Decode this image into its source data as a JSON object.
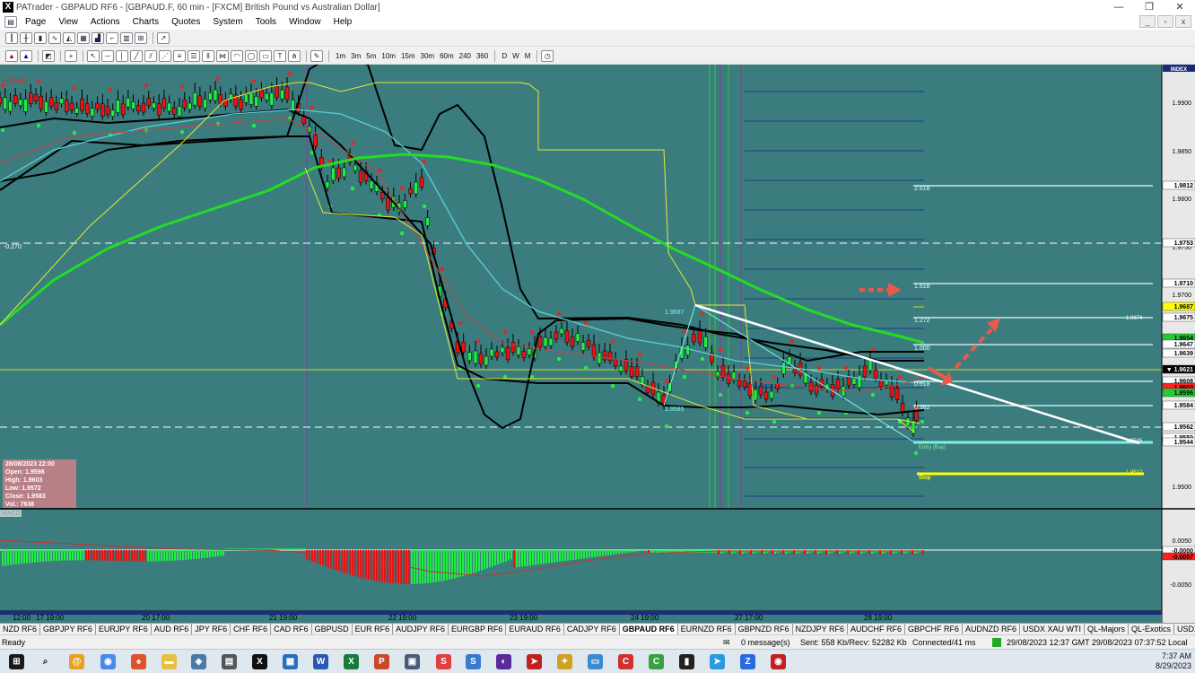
{
  "app": {
    "title": "PATrader - GBPAUD RF6 - [GBPAUD.F, 60 min - [FXCM] British Pound vs Australian Dollar]",
    "window_buttons": [
      "—",
      "❐",
      "✕"
    ]
  },
  "menu": [
    "Page",
    "View",
    "Actions",
    "Charts",
    "Quotes",
    "System",
    "Tools",
    "Window",
    "Help"
  ],
  "mdi_buttons": [
    "_",
    "▫",
    "x"
  ],
  "timeframes": [
    "1m",
    "3m",
    "5m",
    "10m",
    "15m",
    "30m",
    "60m",
    "240",
    "360",
    "D",
    "W",
    "M"
  ],
  "chart": {
    "symbol_panel_label": "INDEX",
    "locked_label": "Locked",
    "left_level_label": "-0.270",
    "y_ticks": [
      "1.9900",
      "1.9850",
      "1.9800",
      "1.9750",
      "1.9700",
      "1.9650",
      "1.9600",
      "1.9550",
      "1.9500"
    ],
    "price_tags": [
      {
        "text": "1.9812",
        "bg": "#ffffff",
        "fg": "#000000"
      },
      {
        "text": "1.9753",
        "bg": "#ffffff",
        "fg": "#000000"
      },
      {
        "text": "1.9710",
        "bg": "#ffffff",
        "fg": "#000000"
      },
      {
        "text": "1.9687",
        "bg": "#ffff00",
        "fg": "#000000"
      },
      {
        "text": "1.9675",
        "bg": "#ffffff",
        "fg": "#000000"
      },
      {
        "text": "1.9654",
        "bg": "#22cc33",
        "fg": "#000000"
      },
      {
        "text": "1.9647",
        "bg": "#ffffff",
        "fg": "#000000"
      },
      {
        "text": "1.9639",
        "bg": "#ffffff",
        "fg": "#000000"
      },
      {
        "text": "▼ 1.9621",
        "bg": "#000000",
        "fg": "#ffffff"
      },
      {
        "text": "1.9608",
        "bg": "#ffffff",
        "fg": "#000000"
      },
      {
        "text": "1.9603",
        "bg": "#ff2020",
        "fg": "#000000"
      },
      {
        "text": "1.9596",
        "bg": "#22cc33",
        "fg": "#000000"
      },
      {
        "text": "1.9584",
        "bg": "#ffffff",
        "fg": "#000000"
      },
      {
        "text": "1.9562",
        "bg": "#ffffff",
        "fg": "#000000"
      },
      {
        "text": "1.9550",
        "bg": "#ffffff",
        "fg": "#000000"
      },
      {
        "text": "1.9544",
        "bg": "#ffffff",
        "fg": "#000000"
      }
    ],
    "fib_labels": [
      "2.618",
      "1.618",
      "1.272",
      "1.000",
      "0.618",
      "0.382"
    ],
    "annotations": {
      "high": "1.9687",
      "low": "1.9585",
      "base": "End Base",
      "target1": "1.9674",
      "entry": "Entry (Buy)",
      "entry_price": "1.9545",
      "stop": "Stop",
      "stop_price": "1.9512"
    },
    "x_labels": [
      "12:00",
      "17 19:00",
      "20 17:00",
      "21 19:00",
      "22 19:00",
      "23 19:00",
      "24 19:00",
      "27 17:00",
      "28 19:00"
    ],
    "info_box": [
      "28/08/2023 22:00",
      "Open: 1.9598",
      "High: 1.9603",
      "Low: 1.9572",
      "Close: 1.9583",
      "Vol.: 7638"
    ],
    "macd": {
      "label": "MACD",
      "y_ticks": [
        "0.0050",
        "0.0000",
        "-0.0050"
      ],
      "tag_white": "-0.0000",
      "tag_red": "-0.0007"
    }
  },
  "tabs": [
    "NZD RF6",
    "GBPJPY RF6",
    "EURJPY RF6",
    "AUD RF6",
    "JPY RF6",
    "CHF RF6",
    "CAD RF6",
    "GBPUSD",
    "EUR RF6",
    "AUDJPY RF6",
    "EURGBP RF6",
    "EURAUD RF6",
    "CADJPY RF6",
    "GBPAUD RF6",
    "EURNZD RF6",
    "GBPNZD RF6",
    "NZDJPY RF6",
    "AUDCHF RF6",
    "GBPCHF RF6",
    "AUDNZD RF6",
    "USDX XAU WTI",
    "QL-Majors",
    "QL-Exotics",
    "USDX RF6",
    "Bitcoin",
    "SP500",
    "DJIA"
  ],
  "active_tab": "GBPAUD RF6",
  "status": {
    "ready": "Ready",
    "messages": "0 message(s)",
    "sent": "Sent: 558 Kb/Recv: 52282 Kb",
    "connected": "Connected/41 ms",
    "time": "29/08/2023 12:37 GMT  29/08/2023 07:37:52 Local"
  },
  "clock": {
    "time": "7:37 AM",
    "date": "8/29/2023"
  },
  "colors": {
    "chart_bg": "#3b7d7f",
    "bull": "#22ee44",
    "bear": "#ee1111",
    "ma_green": "#22dd22",
    "ma_cyan": "#5ad0d8",
    "band": "#000000",
    "yellow": "#e8e830",
    "fib": "#1a3a8a"
  }
}
